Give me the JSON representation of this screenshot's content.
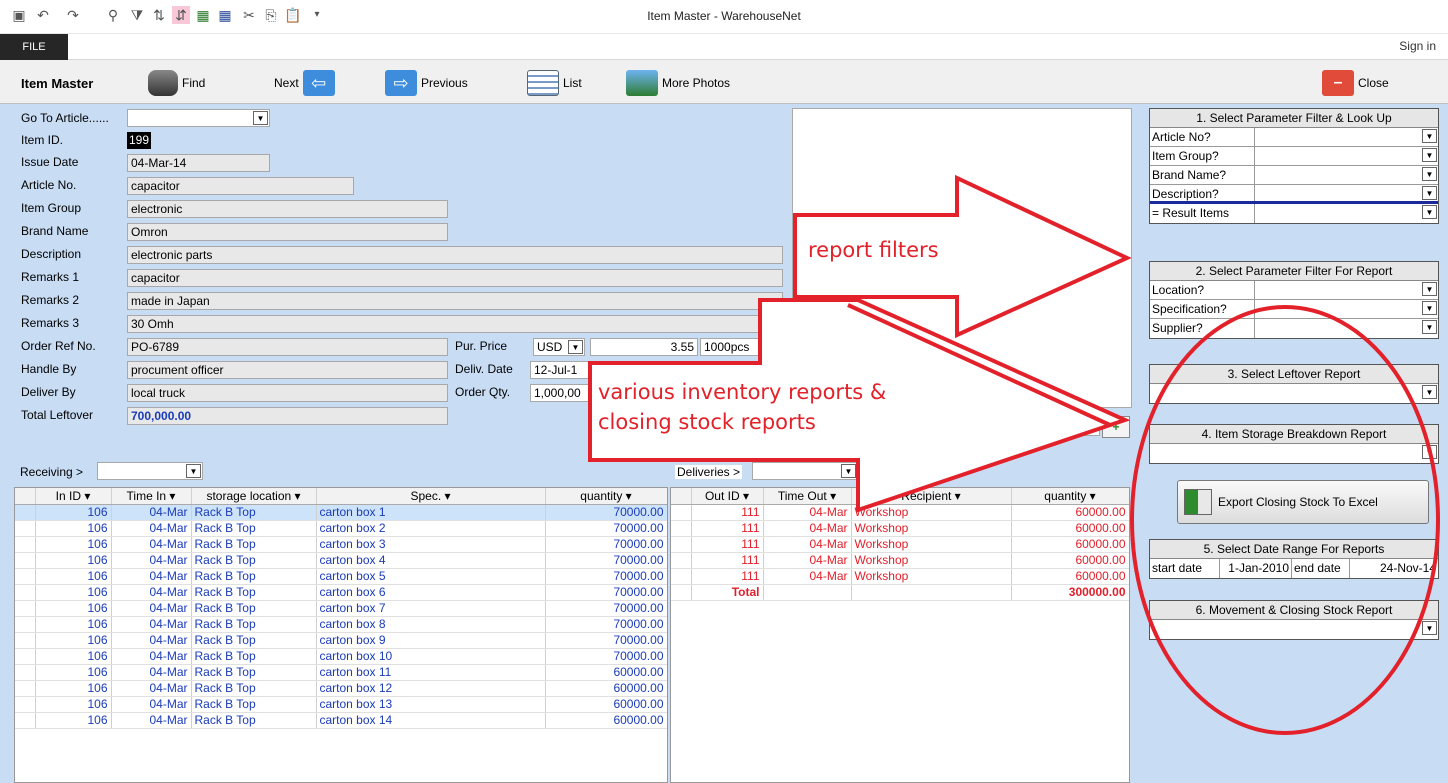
{
  "window": {
    "title": "Item Master - WarehouseNet",
    "file_tab": "FILE",
    "sign_in": "Sign in"
  },
  "toolbar": {
    "form_title": "Item Master",
    "find": "Find",
    "next": "Next",
    "previous": "Previous",
    "list": "List",
    "more_photos": "More Photos",
    "close": "Close"
  },
  "form": {
    "goto_label": "Go To Article......",
    "item_id_label": "Item ID.",
    "item_id": "199",
    "issue_date_label": "Issue Date",
    "issue_date": "04-Mar-14",
    "article_no_label": "Article No.",
    "article_no": "capacitor",
    "item_group_label": "Item Group",
    "item_group": "electronic",
    "brand_name_label": "Brand Name",
    "brand_name": "Omron",
    "description_label": "Description",
    "description": "electronic parts",
    "remarks1_label": "Remarks 1",
    "remarks1": "capacitor",
    "remarks2_label": "Remarks 2",
    "remarks2": "made in Japan",
    "remarks3_label": "Remarks 3",
    "remarks3": "30 Omh",
    "order_ref_label": "Order Ref No.",
    "order_ref": "PO-6789",
    "handle_by_label": "Handle By",
    "handle_by": "procument officer",
    "deliver_by_label": "Deliver By",
    "deliver_by": "local truck",
    "total_leftover_label": "Total Leftover",
    "total_leftover": "700,000.00",
    "pur_price_label": "Pur. Price",
    "pur_currency": "USD",
    "pur_price": "3.55",
    "pur_unit": "1000pcs",
    "deliv_date_label": "Deliv. Date",
    "deliv_date": "12-Jul-1",
    "order_qty_label": "Order Qty.",
    "order_qty": "1,000,00"
  },
  "receiving": {
    "label": "Receiving >",
    "headers": [
      "In ID",
      "Time In",
      "storage location",
      "Spec.",
      "quantity"
    ],
    "rows": [
      [
        "106",
        "04-Mar",
        "Rack B Top",
        "carton box 1",
        "70000.00"
      ],
      [
        "106",
        "04-Mar",
        "Rack B Top",
        "carton box 2",
        "70000.00"
      ],
      [
        "106",
        "04-Mar",
        "Rack B Top",
        "carton box 3",
        "70000.00"
      ],
      [
        "106",
        "04-Mar",
        "Rack B Top",
        "carton box 4",
        "70000.00"
      ],
      [
        "106",
        "04-Mar",
        "Rack B Top",
        "carton box 5",
        "70000.00"
      ],
      [
        "106",
        "04-Mar",
        "Rack B Top",
        "carton box 6",
        "70000.00"
      ],
      [
        "106",
        "04-Mar",
        "Rack B Top",
        "carton box 7",
        "70000.00"
      ],
      [
        "106",
        "04-Mar",
        "Rack B Top",
        "carton box 8",
        "70000.00"
      ],
      [
        "106",
        "04-Mar",
        "Rack B Top",
        "carton box 9",
        "70000.00"
      ],
      [
        "106",
        "04-Mar",
        "Rack B Top",
        "carton box 10",
        "70000.00"
      ],
      [
        "106",
        "04-Mar",
        "Rack B Top",
        "carton box 11",
        "60000.00"
      ],
      [
        "106",
        "04-Mar",
        "Rack B Top",
        "carton box 12",
        "60000.00"
      ],
      [
        "106",
        "04-Mar",
        "Rack B Top",
        "carton box 13",
        "60000.00"
      ],
      [
        "106",
        "04-Mar",
        "Rack B Top",
        "carton box 14",
        "60000.00"
      ]
    ]
  },
  "deliveries": {
    "label": "Deliveries >",
    "headers": [
      "Out ID",
      "Time Out",
      "Recipient",
      "quantity"
    ],
    "rows": [
      [
        "111",
        "04-Mar",
        "Workshop",
        "60000.00"
      ],
      [
        "111",
        "04-Mar",
        "Workshop",
        "60000.00"
      ],
      [
        "111",
        "04-Mar",
        "Workshop",
        "60000.00"
      ],
      [
        "111",
        "04-Mar",
        "Workshop",
        "60000.00"
      ],
      [
        "111",
        "04-Mar",
        "Workshop",
        "60000.00"
      ]
    ],
    "total_label": "Total",
    "total": "300000.00"
  },
  "side": {
    "s1_title": "1. Select Parameter Filter & Look Up",
    "s1_rows": [
      "Article No?",
      "Item Group?",
      "Brand Name?",
      "Description?"
    ],
    "s1_result": "= Result Items",
    "s2_title": "2. Select Parameter Filter For Report",
    "s2_rows": [
      "Location?",
      "Specification?",
      "Supplier?"
    ],
    "s3_title": "3. Select Leftover Report",
    "s4_title": "4. Item Storage Breakdown Report",
    "export": "Export Closing Stock To Excel",
    "s5_title": "5. Select Date Range For  Reports",
    "start_label": "start date",
    "start": "1-Jan-2010",
    "end_label": "end date",
    "end": "24-Nov-14",
    "s6_title": "6. Movement & Closing Stock Report"
  },
  "annotations": {
    "filters": "report filters",
    "reports_line1": "various inventory reports &",
    "reports_line2": "closing stock reports"
  },
  "colors": {
    "annotation": "#e3212a",
    "form_bg": "#c8dcf4",
    "link_blue": "#1a3bb8"
  }
}
